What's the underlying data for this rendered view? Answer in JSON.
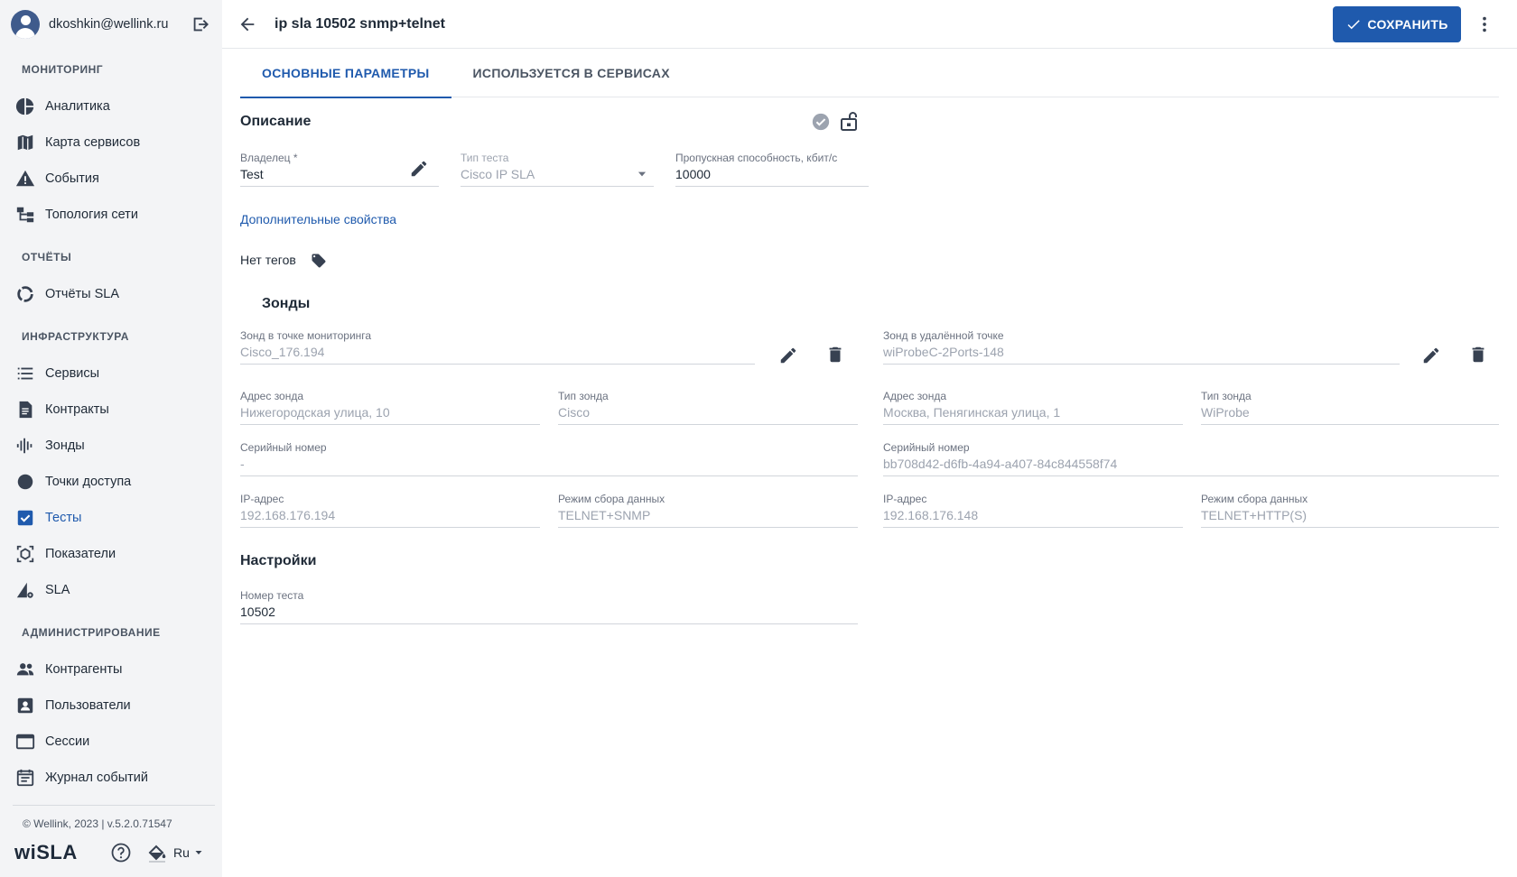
{
  "sidebar": {
    "user_email": "dkoshkin@wellink.ru",
    "sections": [
      {
        "title": "МОНИТОРИНГ"
      },
      {
        "title": "ОТЧЁТЫ"
      },
      {
        "title": "ИНФРАСТРУКТУРА"
      },
      {
        "title": "АДМИНИСТРИРОВАНИЕ"
      }
    ],
    "items": [
      {
        "label": "Аналитика",
        "icon": "pie-chart-icon"
      },
      {
        "label": "Карта сервисов",
        "icon": "map-icon"
      },
      {
        "label": "События",
        "icon": "warning-icon"
      },
      {
        "label": "Топология сети",
        "icon": "topology-icon"
      },
      {
        "label": "Отчёты SLA",
        "icon": "donut-icon"
      },
      {
        "label": "Сервисы",
        "icon": "list-icon"
      },
      {
        "label": "Контракты",
        "icon": "document-icon"
      },
      {
        "label": "Зонды",
        "icon": "waveform-icon"
      },
      {
        "label": "Точки доступа",
        "icon": "circle-icon"
      },
      {
        "label": "Тесты",
        "icon": "checkbox-icon",
        "active": true
      },
      {
        "label": "Показатели",
        "icon": "metrics-icon"
      },
      {
        "label": "SLA",
        "icon": "sla-icon"
      },
      {
        "label": "Контрагенты",
        "icon": "people-icon"
      },
      {
        "label": "Пользователи",
        "icon": "user-card-icon"
      },
      {
        "label": "Сессии",
        "icon": "window-icon"
      },
      {
        "label": "Журнал событий",
        "icon": "calendar-icon"
      }
    ],
    "copyright": "© Wellink, 2023 | v.5.2.0.71547",
    "logo": "wiSLA",
    "language": "Ru"
  },
  "header": {
    "title": "ip sla 10502 snmp+telnet",
    "save_label": "СОХРАНИТЬ"
  },
  "tabs": [
    {
      "label": "ОСНОВНЫЕ ПАРАМЕТРЫ",
      "active": true
    },
    {
      "label": "ИСПОЛЬЗУЕТСЯ В СЕРВИСАХ",
      "active": false
    }
  ],
  "description": {
    "title": "Описание",
    "owner_label": "Владелец *",
    "owner_value": "Test",
    "test_type_label": "Тип теста",
    "test_type_value": "Cisco IP SLA",
    "bandwidth_label": "Пропускная способность, кбит/с",
    "bandwidth_value": "10000",
    "extra_props_link": "Дополнительные свойства",
    "no_tags": "Нет тегов"
  },
  "probes": {
    "title": "Зонды",
    "local": {
      "probe_label": "Зонд в точке мониторинга",
      "probe_value": "Cisco_176.194",
      "address_label": "Адрес зонда",
      "address_value": "Нижегородская улица, 10",
      "type_label": "Тип зонда",
      "type_value": "Cisco",
      "serial_label": "Серийный номер",
      "serial_value": "-",
      "ip_label": "IP-адрес",
      "ip_value": "192.168.176.194",
      "mode_label": "Режим сбора данных",
      "mode_value": "TELNET+SNMP"
    },
    "remote": {
      "probe_label": "Зонд в удалённой точке",
      "probe_value": "wiProbeC-2Ports-148",
      "address_label": "Адрес зонда",
      "address_value": "Москва, Пенягинская улица, 1",
      "type_label": "Тип зонда",
      "type_value": "WiProbe",
      "serial_label": "Серийный номер",
      "serial_value": "bb708d42-d6fb-4a94-a407-84c844558f74",
      "ip_label": "IP-адрес",
      "ip_value": "192.168.176.148",
      "mode_label": "Режим сбора данных",
      "mode_value": "TELNET+HTTP(S)"
    }
  },
  "settings": {
    "title": "Настройки",
    "test_number_label": "Номер теста",
    "test_number_value": "10502"
  },
  "colors": {
    "accent": "#1f5aad",
    "sidebar_bg": "#f3f4f6",
    "icon": "#374151"
  }
}
